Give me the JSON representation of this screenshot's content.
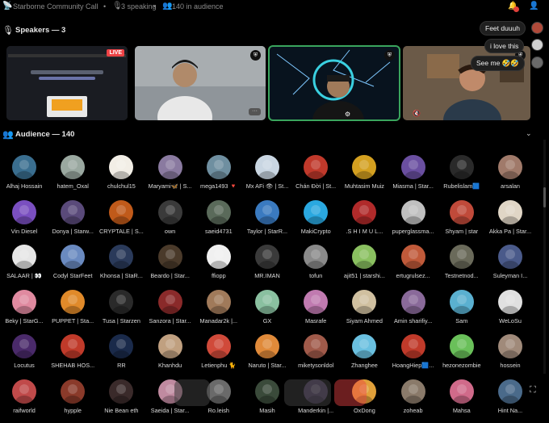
{
  "topbar": {
    "title": "Starborne Community Call",
    "speaking": "3 speaking",
    "audience": "140 in audience"
  },
  "speakers": {
    "header": "Speakers — 3",
    "live_label": "LIVE",
    "tile_colors": [
      "#2d2f36",
      "#8a8f94",
      "#0c1d2a",
      "#6b5a48"
    ]
  },
  "chat": {
    "messages": [
      "Feet duuuh",
      "i love this",
      "See me 🤣🤣"
    ]
  },
  "audience": {
    "header": "Audience — 140",
    "members": [
      {
        "name": "Alhaj Hossain",
        "color": "#3a6e8f"
      },
      {
        "name": "hatem_Oxal",
        "color": "#9aa8a0"
      },
      {
        "name": "chulchul15",
        "color": "#f2eee6"
      },
      {
        "name": "Maryami🦋 | S...",
        "color": "#8a7aa0"
      },
      {
        "name": "mega1493 🔻",
        "color": "#6f8fa0"
      },
      {
        "name": "Mx AFi 👁 | St...",
        "color": "#c9d6e2"
      },
      {
        "name": "Chán Đời | St...",
        "color": "#c0392b"
      },
      {
        "name": "Muhtasim Muiz",
        "color": "#d4a020"
      },
      {
        "name": "Miasma | Star...",
        "color": "#6a4fa0"
      },
      {
        "name": "Rubelislam🟦",
        "color": "#2a2a2a"
      },
      {
        "name": "arsalan",
        "color": "#a07a6a"
      },
      {
        "name": "Vin Diesel",
        "color": "#7a4fc0"
      },
      {
        "name": "Donya | Starw...",
        "color": "#5a4a7a"
      },
      {
        "name": "CRYPTALE | S...",
        "color": "#c05a1a"
      },
      {
        "name": "own",
        "color": "#3a3a3a"
      },
      {
        "name": "saeid4731",
        "color": "#5a6a5a"
      },
      {
        "name": "Taylor | StarR...",
        "color": "#3a7ac0"
      },
      {
        "name": "MakiCrypto",
        "color": "#2aa8e0"
      },
      {
        "name": ".S H I M U L...",
        "color": "#b02a2a"
      },
      {
        "name": "puperglassma...",
        "color": "#c0c0c0"
      },
      {
        "name": "Shyam | star",
        "color": "#c04a3a"
      },
      {
        "name": "Akka Pa | Star...",
        "color": "#e0d6c6"
      },
      {
        "name": "SALAAR | 👀",
        "color": "#e6e6e6"
      },
      {
        "name": "Codyl StarFeet",
        "color": "#6a8ac0"
      },
      {
        "name": "Khonsa | StaR...",
        "color": "#2a3a5a"
      },
      {
        "name": "Beardo | Star...",
        "color": "#4a3a2a"
      },
      {
        "name": "ffiopp",
        "color": "#f0f0f0"
      },
      {
        "name": "MR.IMAN",
        "color": "#3a3a3a"
      },
      {
        "name": "tofun",
        "color": "#8a8a8a"
      },
      {
        "name": "ajit51 | starshi...",
        "color": "#8ac060"
      },
      {
        "name": "ertugrulsez...",
        "color": "#c05a3a"
      },
      {
        "name": "Testnetnod...",
        "color": "#6a6a5a"
      },
      {
        "name": "Suleyman I...",
        "color": "#4a5a8a"
      },
      {
        "name": "Beky | StarG...",
        "color": "#e08aa0"
      },
      {
        "name": "PUPPET | Sta...",
        "color": "#e08a2a"
      },
      {
        "name": "Tusa | Starzen",
        "color": "#2a2a2a"
      },
      {
        "name": "Sanzora | Star...",
        "color": "#8a2a2a"
      },
      {
        "name": "Manadar2k |...",
        "color": "#a07a5a"
      },
      {
        "name": "GX",
        "color": "#8ac0a0"
      },
      {
        "name": "Masrafe",
        "color": "#c07ab0"
      },
      {
        "name": "Siyam Ahmed",
        "color": "#d0c0a0"
      },
      {
        "name": "Amin sharifiy...",
        "color": "#8a6a9a"
      },
      {
        "name": "Sam",
        "color": "#5ab0d0"
      },
      {
        "name": "WeLoSu",
        "color": "#e0e0e0"
      },
      {
        "name": "Locutus",
        "color": "#4a2a6a"
      },
      {
        "name": "SHEHAB HOS...",
        "color": "#c03a2a"
      },
      {
        "name": "RR",
        "color": "#1a2a4a"
      },
      {
        "name": "Khanhdu",
        "color": "#c0a080"
      },
      {
        "name": "Letienphu 🐈",
        "color": "#d04a3a"
      },
      {
        "name": "Naruto | Star...",
        "color": "#e08a3a"
      },
      {
        "name": "miketysonldol",
        "color": "#a05a4a"
      },
      {
        "name": "Zhanghee",
        "color": "#6ac0e0"
      },
      {
        "name": "HoangHiep🟦...",
        "color": "#c03a2a"
      },
      {
        "name": "hezonezombie",
        "color": "#6ac05a"
      },
      {
        "name": "hossein",
        "color": "#a08a7a"
      },
      {
        "name": "raifworld",
        "color": "#c04a4a"
      },
      {
        "name": "hypple",
        "color": "#8a3a2a"
      },
      {
        "name": "Nie Bean eth",
        "color": "#3a2a2a"
      },
      {
        "name": "Saeida | Star...",
        "color": "#c08aa0"
      },
      {
        "name": "Ro.leish",
        "color": "#6a6a6a"
      },
      {
        "name": "Masih",
        "color": "#3a4a3a"
      },
      {
        "name": "Manderkin |...",
        "color": "#4a3a5a"
      },
      {
        "name": "OxDong",
        "color": "#e0a03a"
      },
      {
        "name": "zoheab",
        "color": "#8a7a6a"
      },
      {
        "name": "Mahsa",
        "color": "#d06a8a"
      },
      {
        "name": "Hint Na...",
        "color": "#4a6a8a"
      }
    ]
  }
}
